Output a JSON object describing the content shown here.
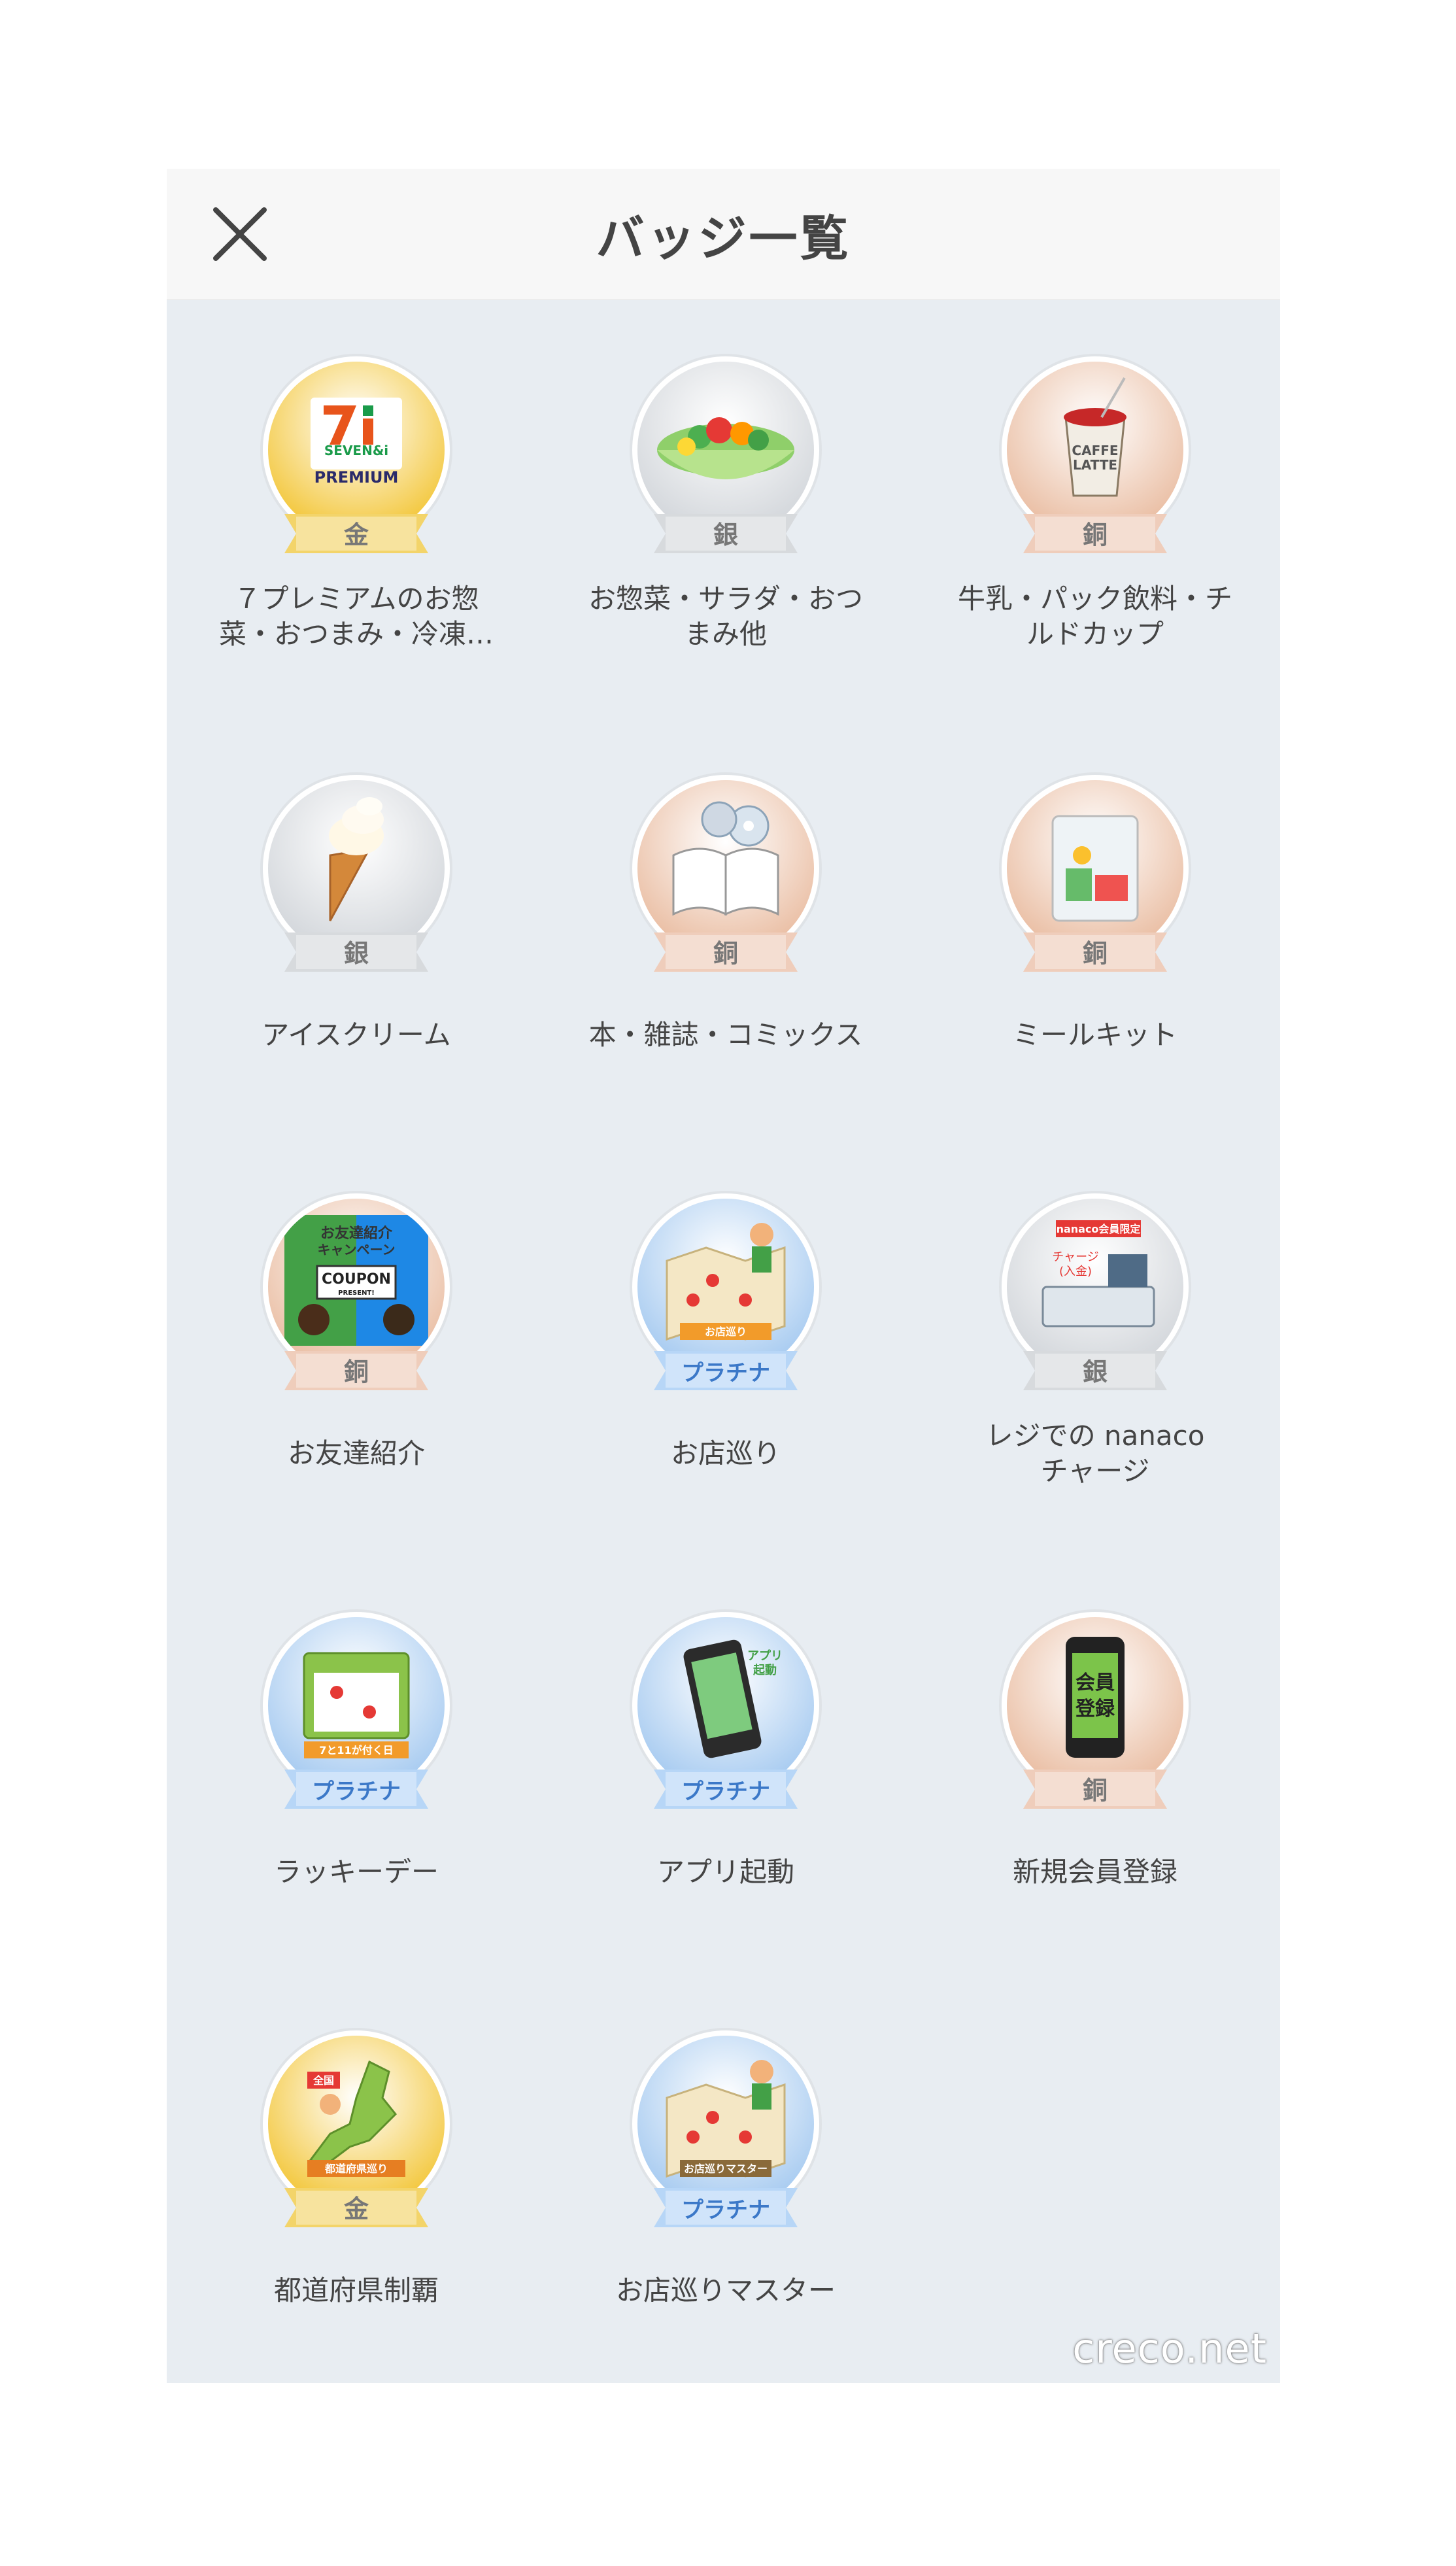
{
  "header": {
    "title": "バッジ一覧",
    "close_icon": "close-icon"
  },
  "colors": {
    "gold": "#f2c22a",
    "silver": "#cfd3d8",
    "bronze": "#e8b89b",
    "platinum": "#9fc6ef",
    "gold_ribbon": "#f3d46a",
    "silver_ribbon": "#d7dadd",
    "bronze_ribbon": "#efcdbb",
    "platinum_ribbon": "#b7d6f7",
    "platinum_ribbon_text": "#3b78c8"
  },
  "badges": [
    {
      "label": "７プレミアムのお惣\n菜・おつまみ・冷凍…",
      "rank": "金",
      "tier": "gold",
      "icon": "seven-premium-logo-icon",
      "logo_text": [
        "SEVEN&i",
        "PREMIUM"
      ]
    },
    {
      "label": "お惣菜・サラダ・おつ\nまみ他",
      "rank": "銀",
      "tier": "silver",
      "icon": "salad-bowl-icon"
    },
    {
      "label": "牛乳・パック飲料・チ\nルドカップ",
      "rank": "銅",
      "tier": "bronze",
      "icon": "caffe-latte-cup-icon",
      "logo_text": [
        "CAFFE",
        "LATTE"
      ]
    },
    {
      "label": "アイスクリーム",
      "rank": "銀",
      "tier": "silver",
      "icon": "ice-cream-cone-icon"
    },
    {
      "label": "本・雑誌・コミックス",
      "rank": "銅",
      "tier": "bronze",
      "icon": "book-and-disc-icon"
    },
    {
      "label": "ミールキット",
      "rank": "銅",
      "tier": "bronze",
      "icon": "meal-kit-bag-icon"
    },
    {
      "label": "お友達紹介",
      "rank": "銅",
      "tier": "bronze",
      "icon": "friend-referral-coupon-icon",
      "logo_text": [
        "お友達紹介",
        "キャンペーン",
        "COUPON",
        "PRESENT!"
      ]
    },
    {
      "label": "お店巡り",
      "rank": "プラチナ",
      "tier": "platinum",
      "icon": "store-map-icon",
      "logo_text": [
        "お店巡り"
      ]
    },
    {
      "label": "レジでの nanaco\nチャージ",
      "rank": "銀",
      "tier": "silver",
      "icon": "cash-register-icon",
      "logo_text": [
        "nanaco会員限定",
        "チャージ",
        "(入金)"
      ]
    },
    {
      "label": "ラッキーデー",
      "rank": "プラチナ",
      "tier": "platinum",
      "icon": "calendar-icon",
      "logo_text": [
        "7と11が付く日"
      ]
    },
    {
      "label": "アプリ起動",
      "rank": "プラチナ",
      "tier": "platinum",
      "icon": "smartphone-app-icon",
      "logo_text": [
        "アプリ",
        "起動"
      ]
    },
    {
      "label": "新規会員登録",
      "rank": "銅",
      "tier": "bronze",
      "icon": "phone-registration-icon",
      "logo_text": [
        "会員",
        "登録"
      ]
    },
    {
      "label": "都道府県制覇",
      "rank": "金",
      "tier": "gold",
      "icon": "japan-map-icon",
      "logo_text": [
        "全国",
        "都道府県巡り"
      ]
    },
    {
      "label": "お店巡りマスター",
      "rank": "プラチナ",
      "tier": "platinum",
      "icon": "store-map-master-icon",
      "logo_text": [
        "お店巡りマスター"
      ]
    }
  ],
  "watermark": "creco.net"
}
